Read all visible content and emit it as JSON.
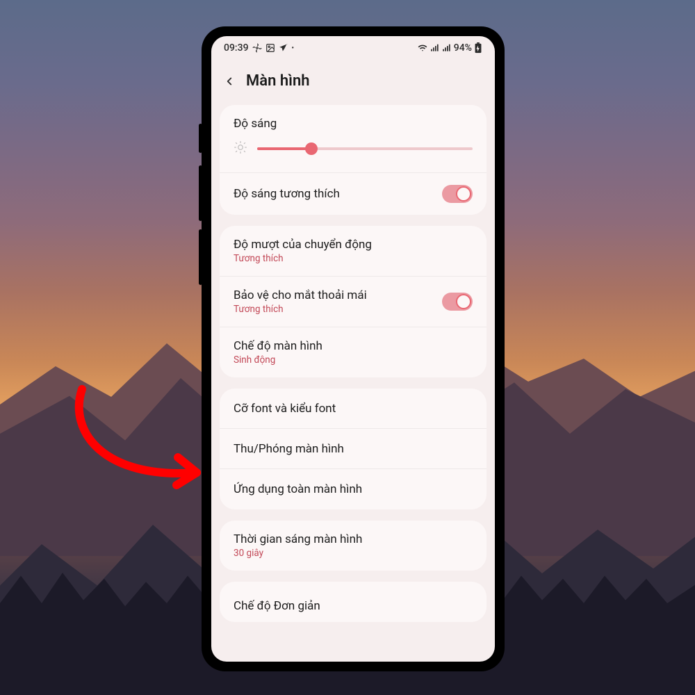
{
  "status": {
    "time": "09:39",
    "battery": "94%"
  },
  "header": {
    "title": "Màn hình"
  },
  "cards": {
    "brightness": {
      "label": "Độ sáng",
      "adaptive_label": "Độ sáng tương thích",
      "slider_percent": 25,
      "adaptive_on": true
    },
    "motion": {
      "smoothness_label": "Độ mượt của chuyển động",
      "smoothness_sub": "Tương thích",
      "eye_label": "Bảo vệ cho mắt thoải mái",
      "eye_sub": "Tương thích",
      "eye_on": true,
      "mode_label": "Chế độ màn hình",
      "mode_sub": "Sinh động"
    },
    "fonts": {
      "font_label": "Cỡ font và kiểu font",
      "zoom_label": "Thu/Phóng màn hình",
      "fullscreen_label": "Ứng dụng toàn màn hình"
    },
    "timeout": {
      "timeout_label": "Thời gian sáng màn hình",
      "timeout_sub": "30 giây"
    },
    "simple": {
      "simple_label": "Chế độ Đơn giản"
    }
  },
  "colors": {
    "accent": "#e96772",
    "sub": "#c24857"
  }
}
